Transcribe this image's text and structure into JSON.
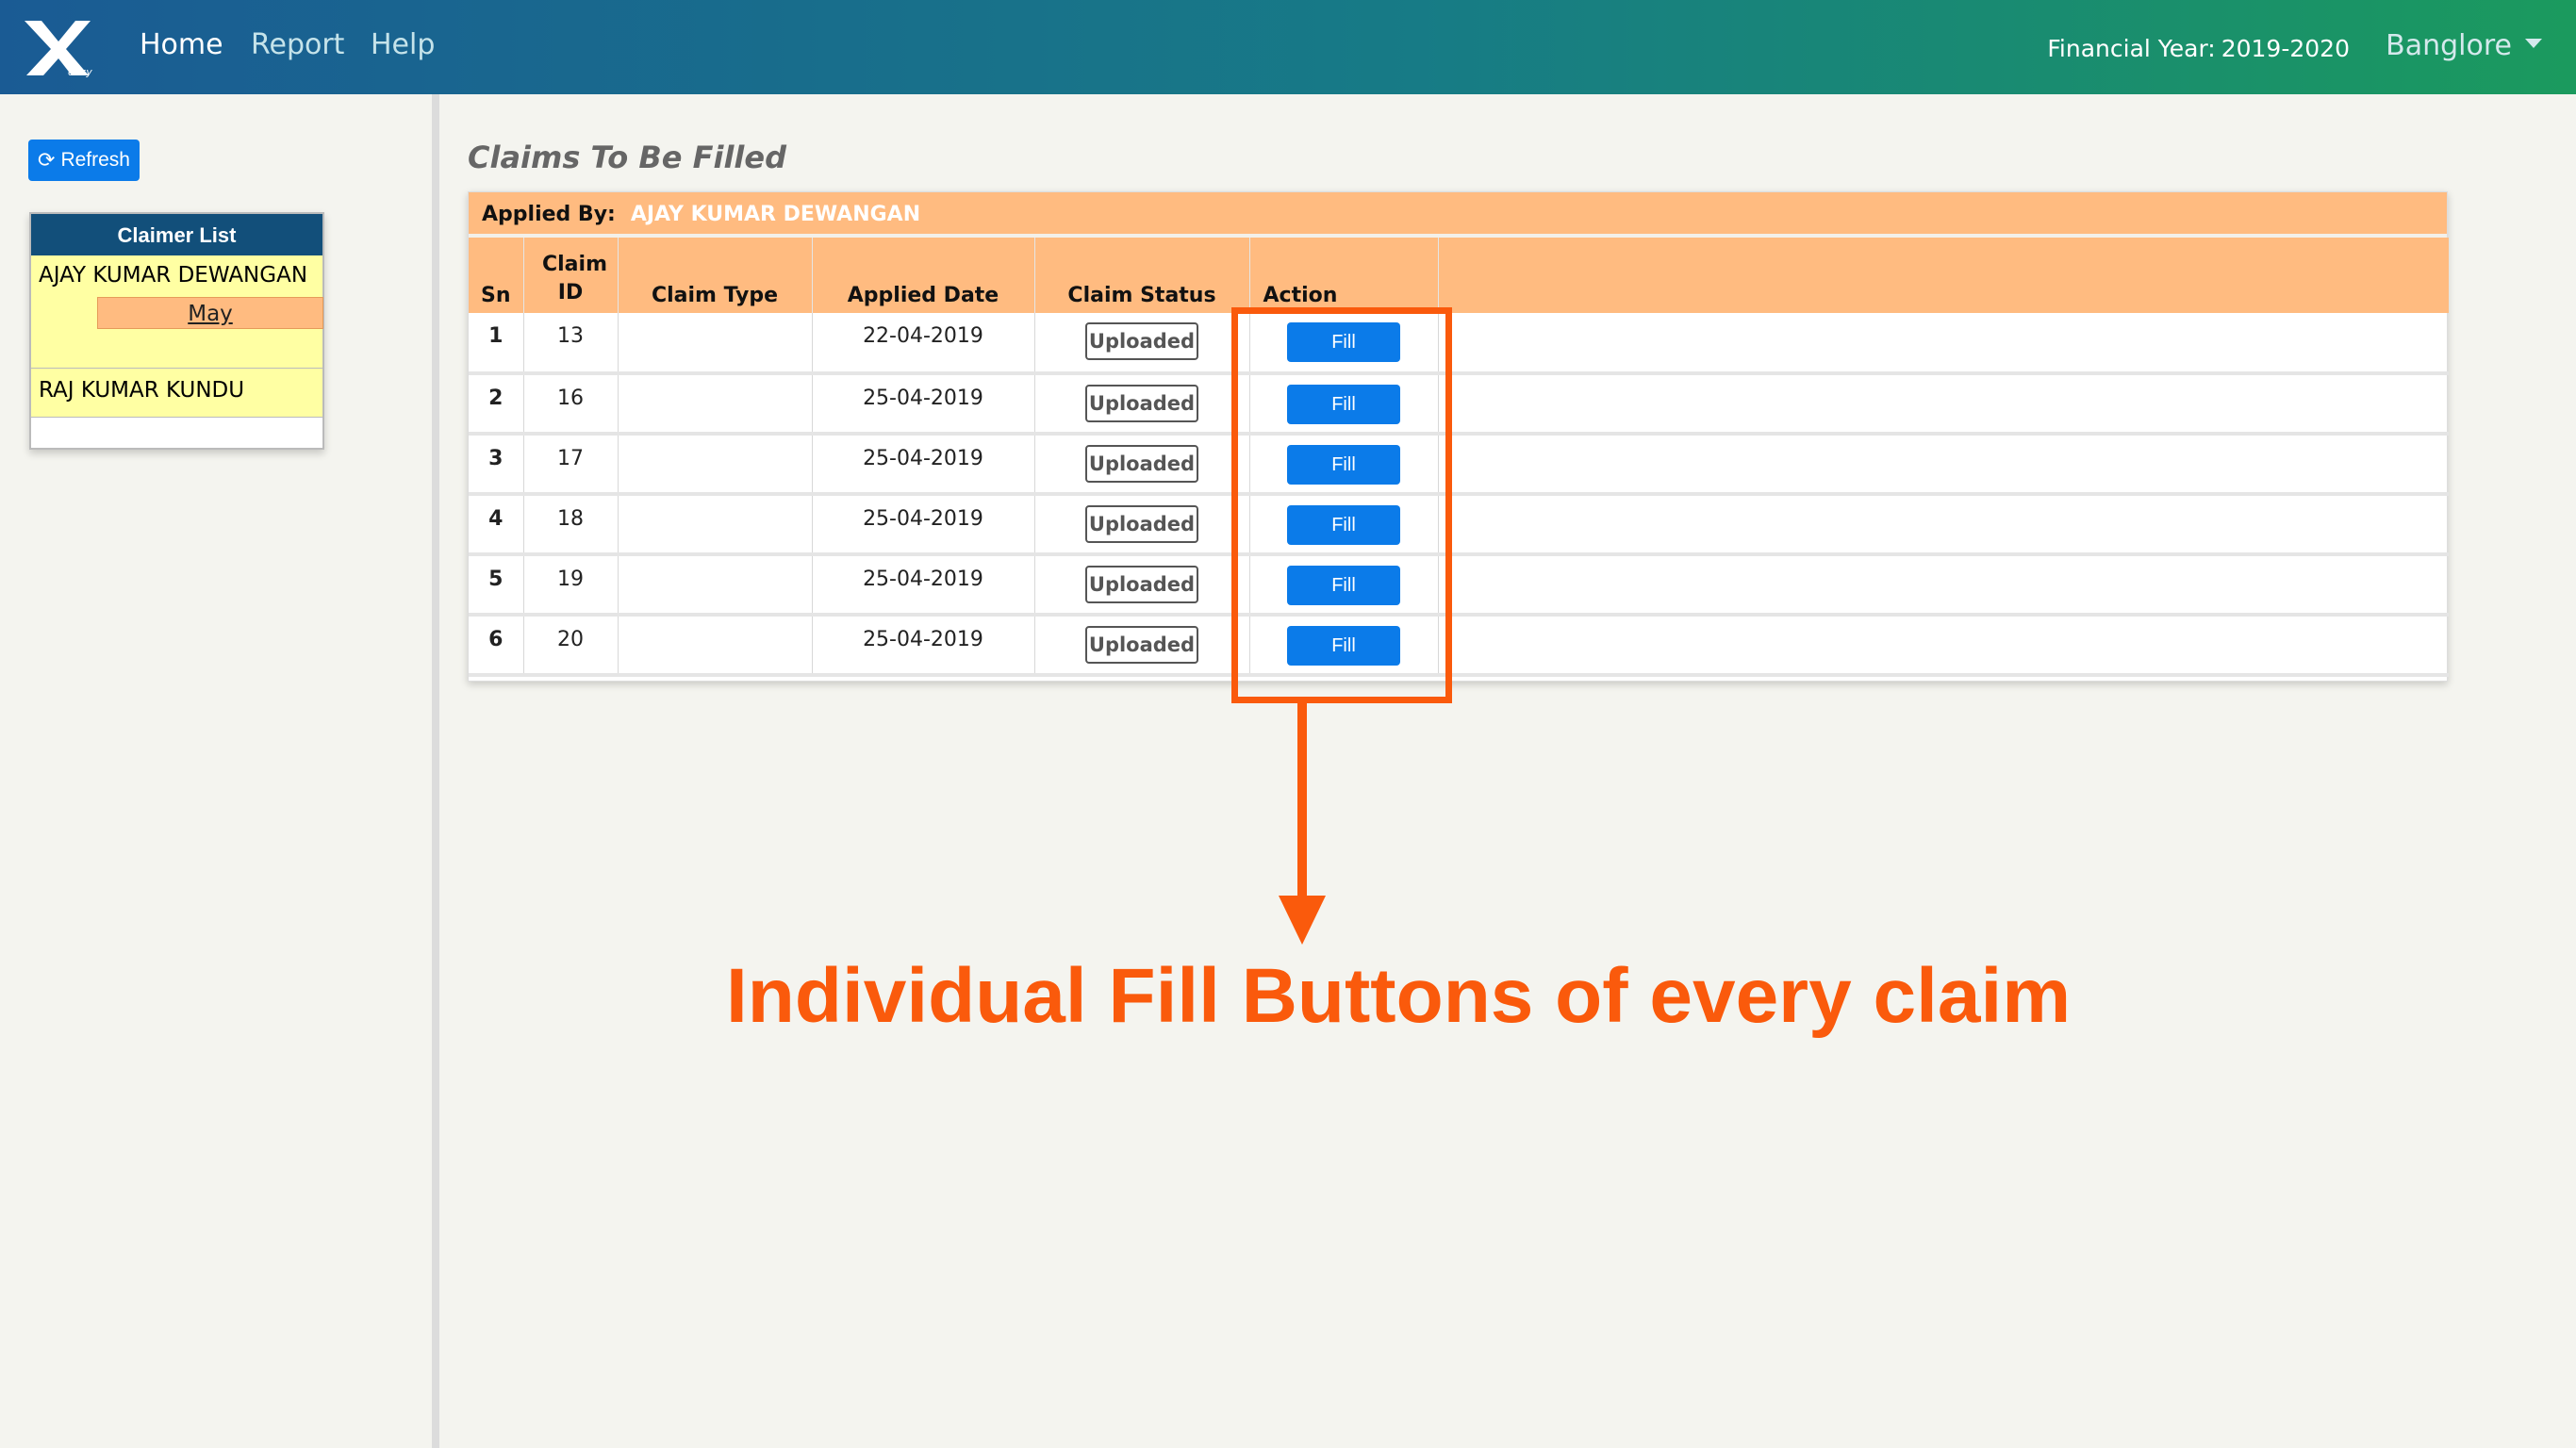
{
  "navbar": {
    "logo_icon": "x-logo-icon",
    "links": [
      {
        "label": "Home",
        "active": true
      },
      {
        "label": "Report",
        "active": false
      },
      {
        "label": "Help",
        "active": false
      }
    ],
    "financial_year_label": "Financial Year:",
    "financial_year_value": "2019-2020",
    "location": "Banglore",
    "location_caret_icon": "caret-down-icon"
  },
  "sidebar": {
    "refresh_label": "Refresh",
    "refresh_icon": "refresh-icon",
    "claimer_list_title": "Claimer List",
    "claimers": [
      {
        "name": "AJAY KUMAR DEWANGAN",
        "month": "May"
      },
      {
        "name": "RAJ KUMAR KUNDU"
      }
    ]
  },
  "main": {
    "title": "Claims To Be Filled",
    "applied_by_label": "Applied By:",
    "applied_by_value": "AJAY KUMAR DEWANGAN",
    "columns": [
      "Sn",
      "Claim ID",
      "Claim Type",
      "Applied Date",
      "Claim Status",
      "Action"
    ],
    "rows": [
      {
        "sn": "1",
        "claim_id": "13",
        "claim_type": "",
        "applied_date": "22-04-2019",
        "status": "Uploaded",
        "action": "Fill"
      },
      {
        "sn": "2",
        "claim_id": "16",
        "claim_type": "",
        "applied_date": "25-04-2019",
        "status": "Uploaded",
        "action": "Fill"
      },
      {
        "sn": "3",
        "claim_id": "17",
        "claim_type": "",
        "applied_date": "25-04-2019",
        "status": "Uploaded",
        "action": "Fill"
      },
      {
        "sn": "4",
        "claim_id": "18",
        "claim_type": "",
        "applied_date": "25-04-2019",
        "status": "Uploaded",
        "action": "Fill"
      },
      {
        "sn": "5",
        "claim_id": "19",
        "claim_type": "",
        "applied_date": "25-04-2019",
        "status": "Uploaded",
        "action": "Fill"
      },
      {
        "sn": "6",
        "claim_id": "20",
        "claim_type": "",
        "applied_date": "25-04-2019",
        "status": "Uploaded",
        "action": "Fill"
      }
    ]
  },
  "annotation": {
    "text": "Individual Fill Buttons of every claim",
    "color": "#fa5a0c"
  },
  "colors": {
    "accent_blue": "#0b7be9",
    "header_orange": "#ffbb80",
    "claimer_yellow": "#ffffa3",
    "claimer_header": "#124f7a"
  }
}
